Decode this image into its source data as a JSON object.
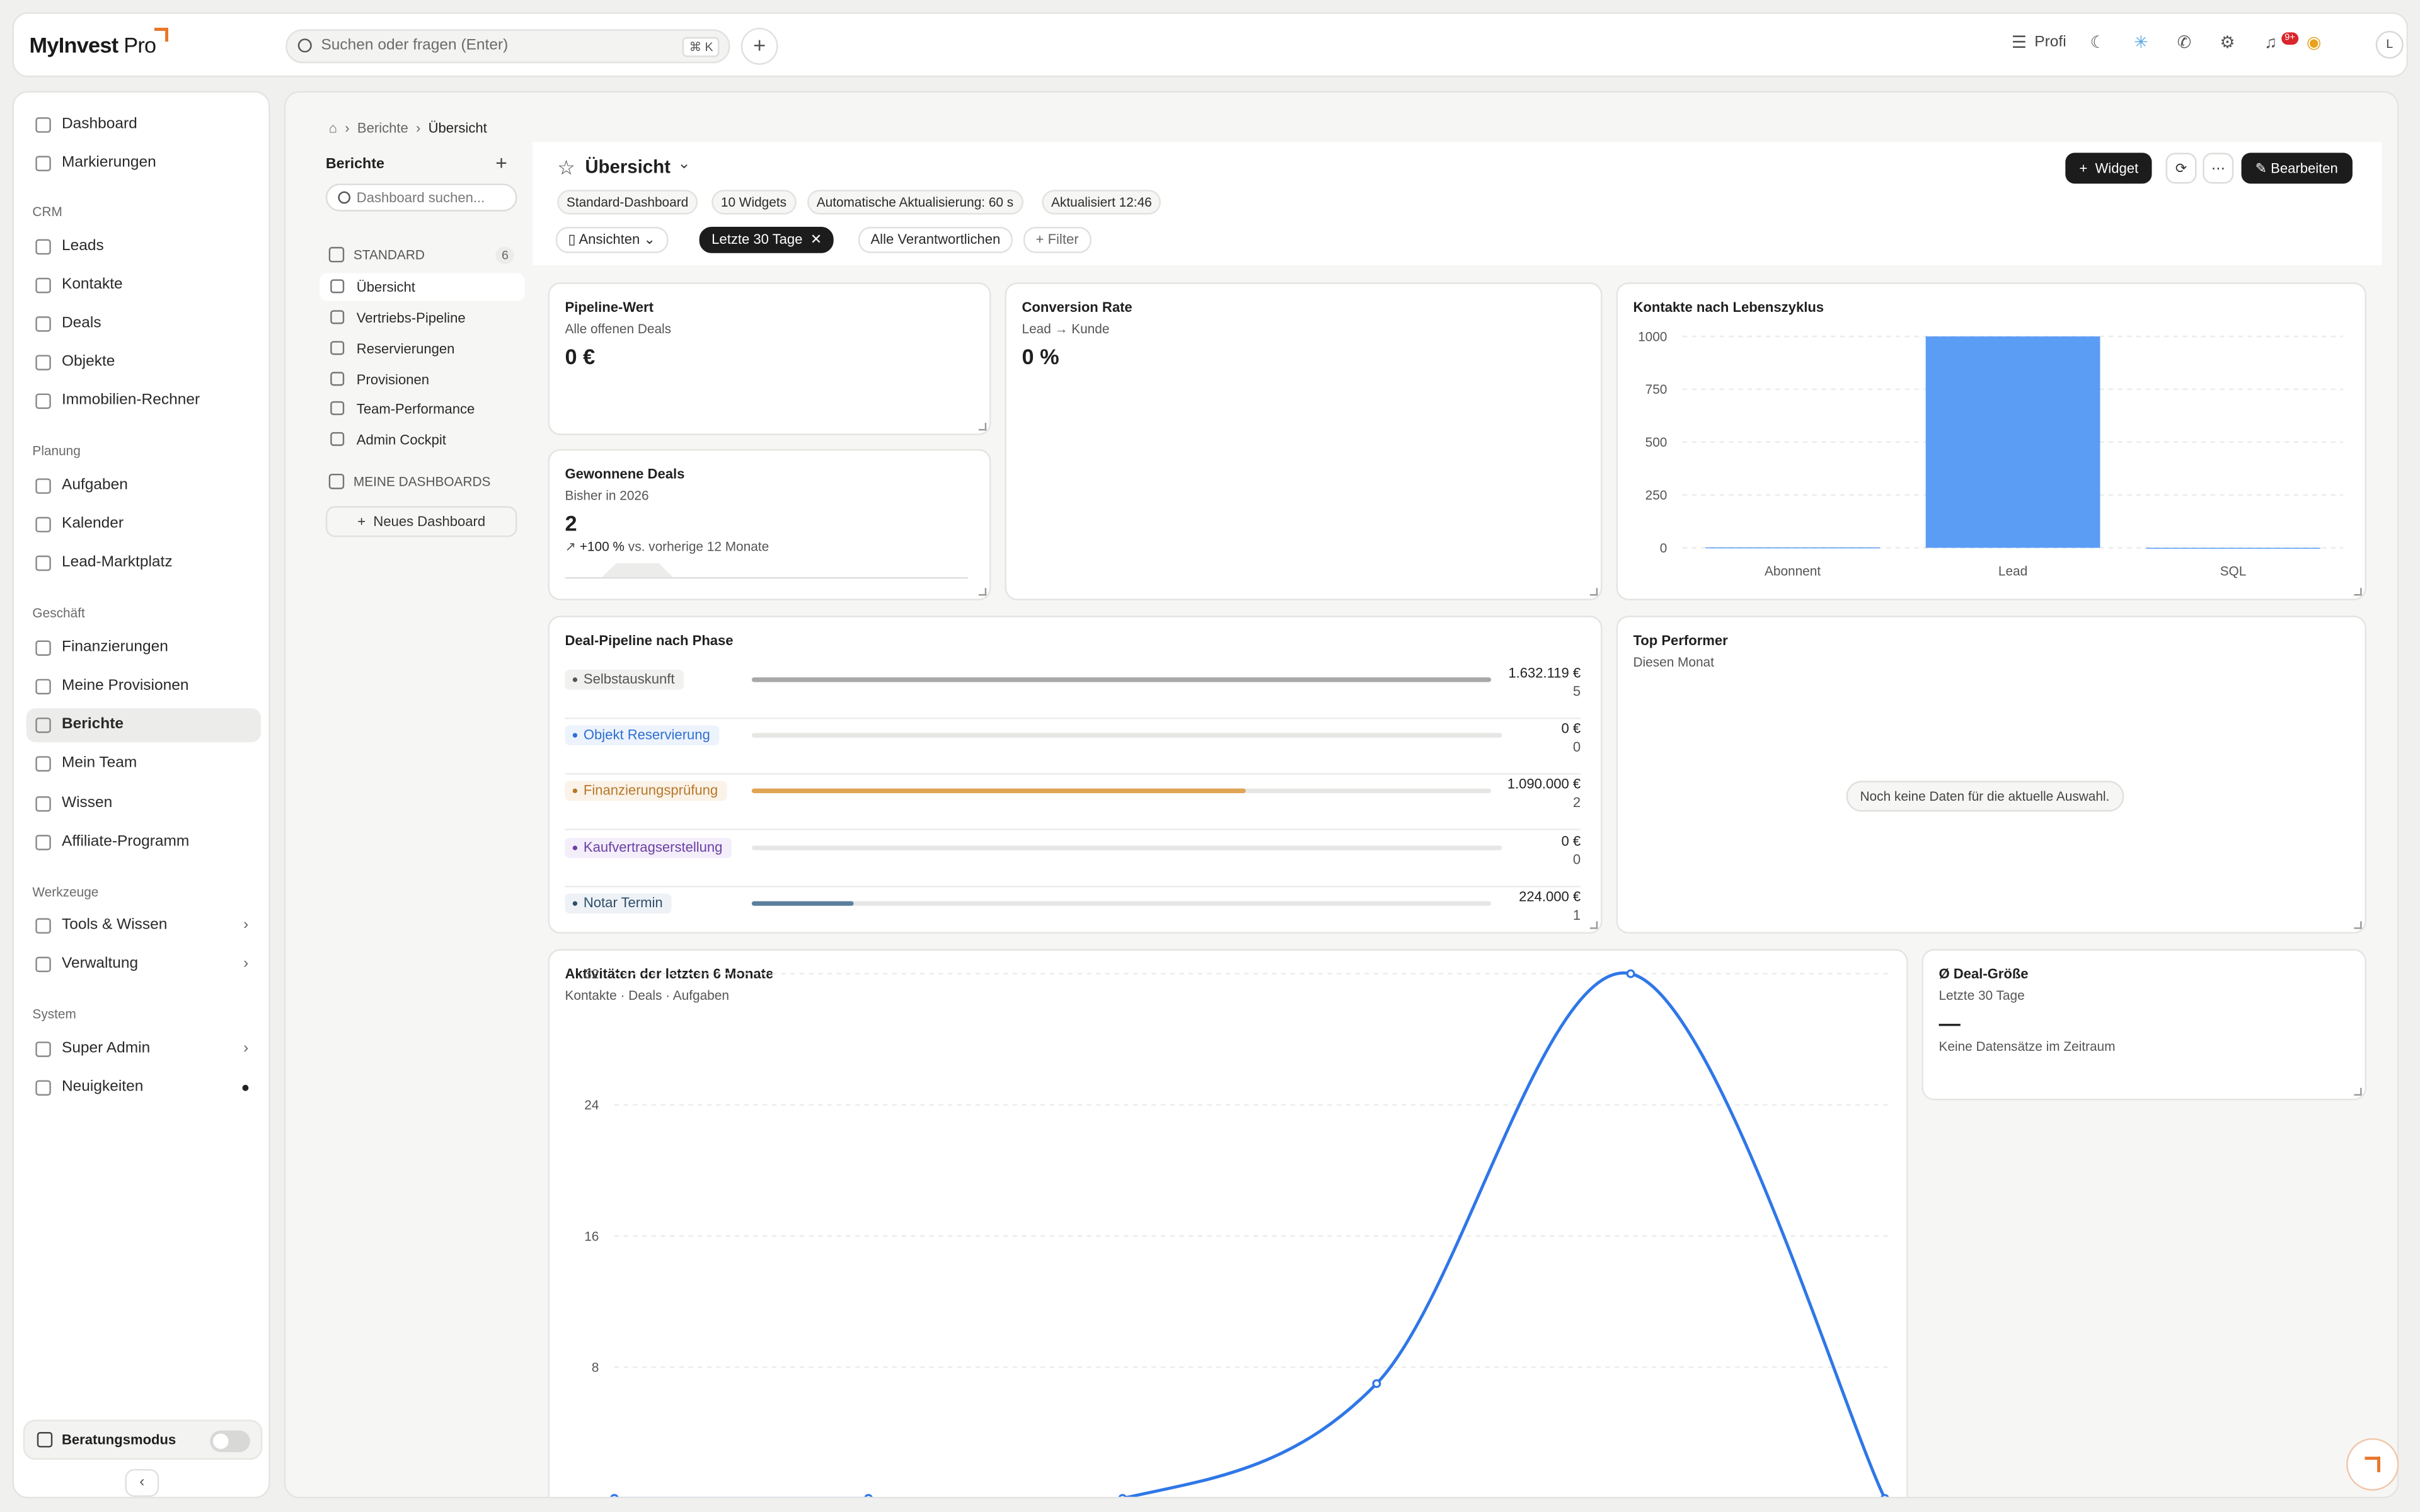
{
  "app": {
    "logo_text": "MyInvest",
    "logo_pro": "Pro"
  },
  "topbar": {
    "search_placeholder": "Suchen oder fragen (Enter)",
    "search_shortcut": "⌘ K",
    "profile_label": "Profi",
    "notif_badge": "9+",
    "avatar_initial": "L"
  },
  "sidebar": {
    "top": [
      {
        "label": "Dashboard"
      },
      {
        "label": "Markierungen"
      }
    ],
    "sections": [
      {
        "title": "CRM",
        "items": [
          "Leads",
          "Kontakte",
          "Deals",
          "Objekte",
          "Immobilien-Rechner"
        ]
      },
      {
        "title": "Planung",
        "items": [
          "Aufgaben",
          "Kalender",
          "Lead-Marktplatz"
        ]
      },
      {
        "title": "Geschäft",
        "items": [
          "Finanzierungen",
          "Meine Provisionen",
          "Berichte",
          "Mein Team",
          "Wissen",
          "Affiliate-Programm"
        ]
      },
      {
        "title": "Werkzeuge",
        "items": [
          "Tools & Wissen",
          "Verwaltung"
        ]
      },
      {
        "title": "System",
        "items": [
          "Super Admin",
          "Neuigkeiten"
        ]
      }
    ],
    "beratungsmodus": "Beratungsmodus"
  },
  "breadcrumb": {
    "section": "Berichte",
    "current": "Übersicht"
  },
  "subnav": {
    "title": "Berichte",
    "search_placeholder": "Dashboard suchen...",
    "standard_label": "STANDARD",
    "standard_count": "6",
    "items": [
      "Übersicht",
      "Vertriebs-Pipeline",
      "Reservierungen",
      "Provisionen",
      "Team-Performance",
      "Admin Cockpit"
    ],
    "my_label": "MEINE DASHBOARDS",
    "new_dashboard": "Neues Dashboard"
  },
  "header": {
    "title": "Übersicht",
    "chips": [
      "Standard-Dashboard",
      "10 Widgets",
      "Automatische Aktualisierung: 60 s",
      "Aktualisiert 12:46"
    ],
    "views": "Ansichten",
    "period": "Letzte 30 Tage",
    "owner": "Alle Verantwortlichen",
    "filter": "Filter",
    "widget_btn": "Widget",
    "edit_btn": "Bearbeiten"
  },
  "widgets": {
    "pipeline_value": {
      "title": "Pipeline-Wert",
      "subtitle": "Alle offenen Deals",
      "value": "0 €"
    },
    "conversion": {
      "title": "Conversion Rate",
      "subtitle": "Lead → Kunde",
      "value": "0 %"
    },
    "won_deals": {
      "title": "Gewonnene Deals",
      "subtitle": "Bisher in 2026",
      "value": "2",
      "trend_value": "+100 %",
      "trend_text": "vs. vorherige 12 Monate"
    },
    "lifecycle": {
      "title": "Kontakte nach Lebenszyklus"
    },
    "deal_pipeline": {
      "title": "Deal-Pipeline nach Phase",
      "rows": [
        {
          "label": "Selbstauskunft",
          "amount": "1.632.119 €",
          "count": "5",
          "fraction": 1.0,
          "color": "#a8a8a8",
          "text_color": "#555555",
          "bg": "#f1f1f0"
        },
        {
          "label": "Objekt Reservierung",
          "amount": "0 €",
          "count": "0",
          "fraction": 0,
          "color": "#3a7bd5",
          "text_color": "#2f6fd0",
          "bg": "#edf3fc"
        },
        {
          "label": "Finanzierungsprüfung",
          "amount": "1.090.000 €",
          "count": "2",
          "fraction": 0.668,
          "color": "#e0a455",
          "text_color": "#b7772a",
          "bg": "#fbf3e8"
        },
        {
          "label": "Kaufvertragserstellung",
          "amount": "0 €",
          "count": "0",
          "fraction": 0,
          "color": "#7a4bb0",
          "text_color": "#6b3fa3",
          "bg": "#f3eefa"
        },
        {
          "label": "Notar Termin",
          "amount": "224.000 €",
          "count": "1",
          "fraction": 0.137,
          "color": "#5d7f9e",
          "text_color": "#2d4d6b",
          "bg": "#eef2f6"
        }
      ]
    },
    "top_performer": {
      "title": "Top Performer",
      "subtitle": "Diesen Monat",
      "empty": "Noch keine Daten für die aktuelle Auswahl."
    },
    "activities": {
      "title": "Aktivitäten der letzten 6 Monate",
      "subtitle": "Kontakte · Deals · Aufgaben"
    },
    "deal_size": {
      "title": "Ø Deal-Größe",
      "subtitle": "Letzte 30 Tage",
      "value": "—",
      "note": "Keine Datensätze im Zeitraum"
    }
  },
  "chart_data": [
    {
      "type": "bar",
      "title": "Kontakte nach Lebenszyklus",
      "categories": [
        "Abonnent",
        "Lead",
        "SQL"
      ],
      "values": [
        2,
        1000,
        0
      ],
      "ylim": [
        0,
        1000
      ],
      "yticks": [
        0,
        250,
        500,
        750,
        1000
      ],
      "color": "#5b9cf5",
      "grid": true
    },
    {
      "type": "line",
      "title": "Aktivitäten der letzten 6 Monate",
      "subtitle": "Kontakte · Deals · Aufgaben",
      "x": [
        0,
        1,
        2,
        3,
        4,
        5
      ],
      "values": [
        0,
        0,
        0,
        7,
        32,
        0
      ],
      "yticks": [
        8,
        16,
        24,
        32
      ],
      "color": "#2f77e8",
      "grid": true
    }
  ]
}
